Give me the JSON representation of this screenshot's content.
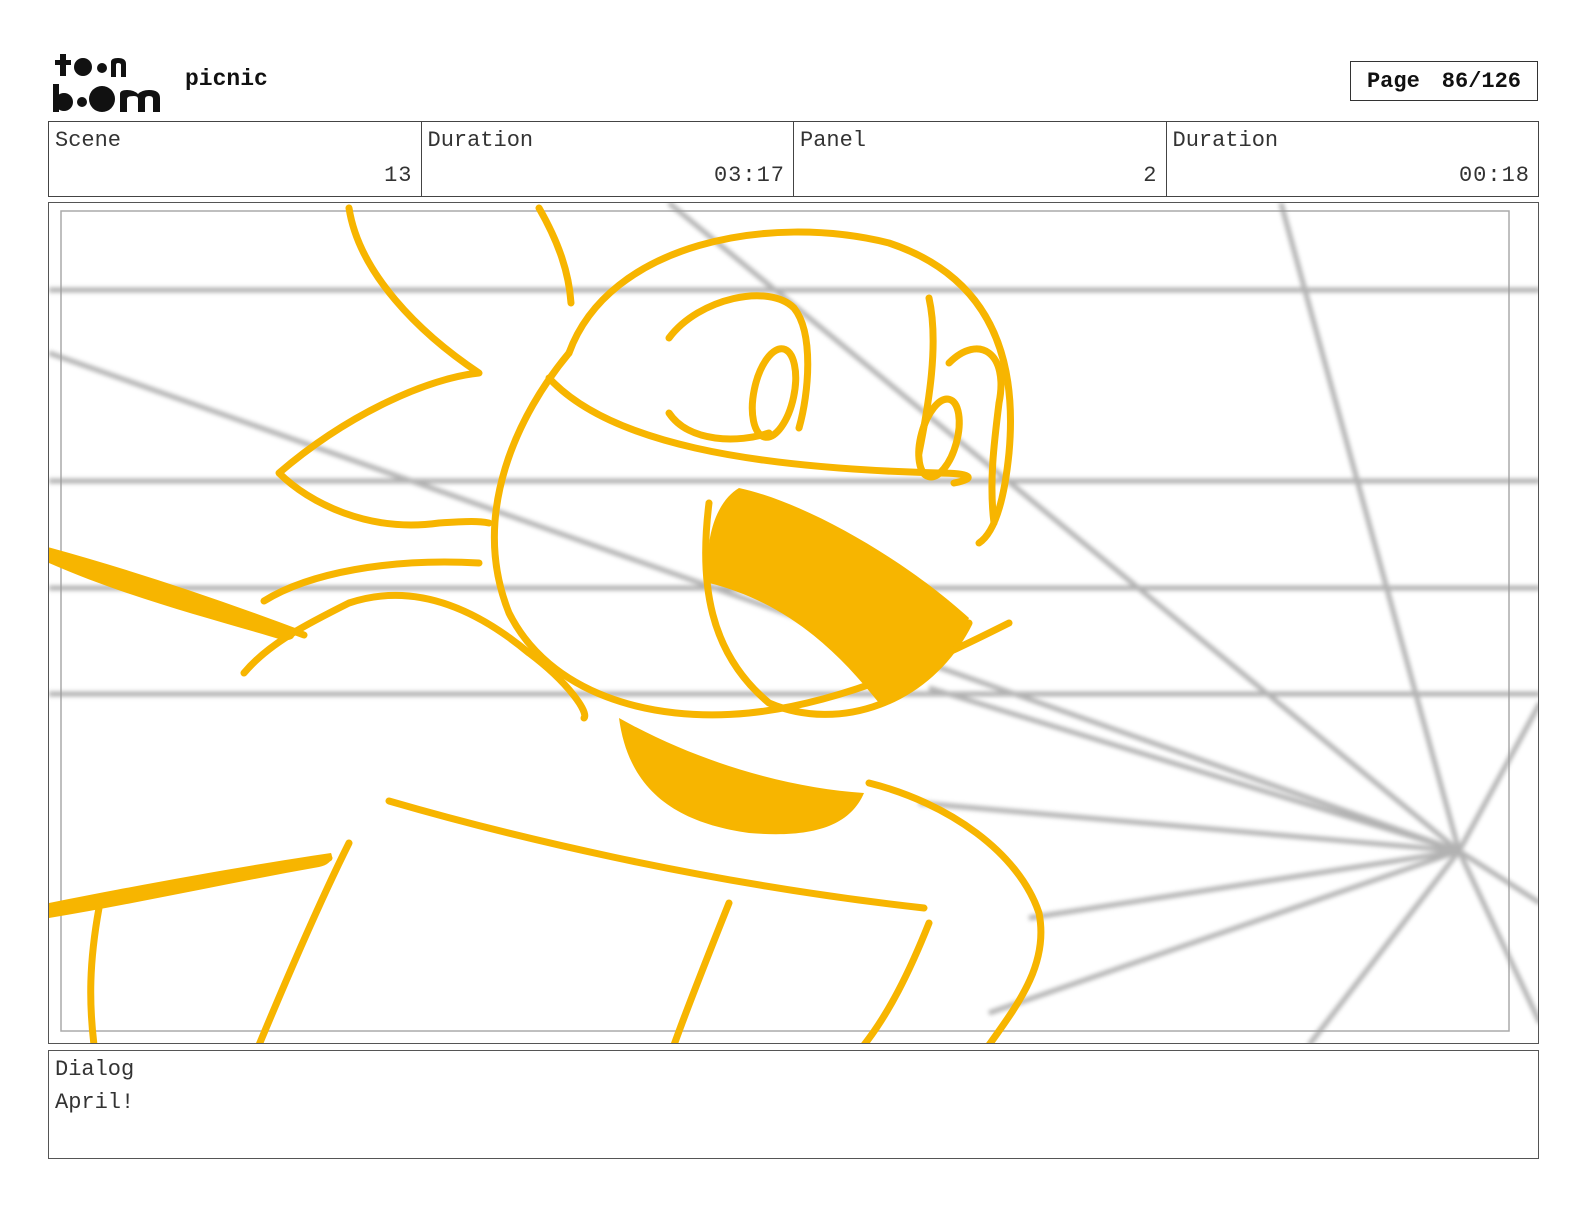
{
  "header": {
    "logo": {
      "line1": "toon",
      "line2": "boom"
    },
    "project_title": "picnic",
    "page_label": "Page",
    "page_number": "86/126"
  },
  "info": {
    "scene_label": "Scene",
    "scene_value": "13",
    "scene_duration_label": "Duration",
    "scene_duration_value": "03:17",
    "panel_label": "Panel",
    "panel_value": "2",
    "panel_duration_label": "Duration",
    "panel_duration_value": "00:18"
  },
  "dialog": {
    "label": "Dialog",
    "text": "April!"
  },
  "colors": {
    "sketch": "#f7b500",
    "grid": "#9a9a9a"
  }
}
